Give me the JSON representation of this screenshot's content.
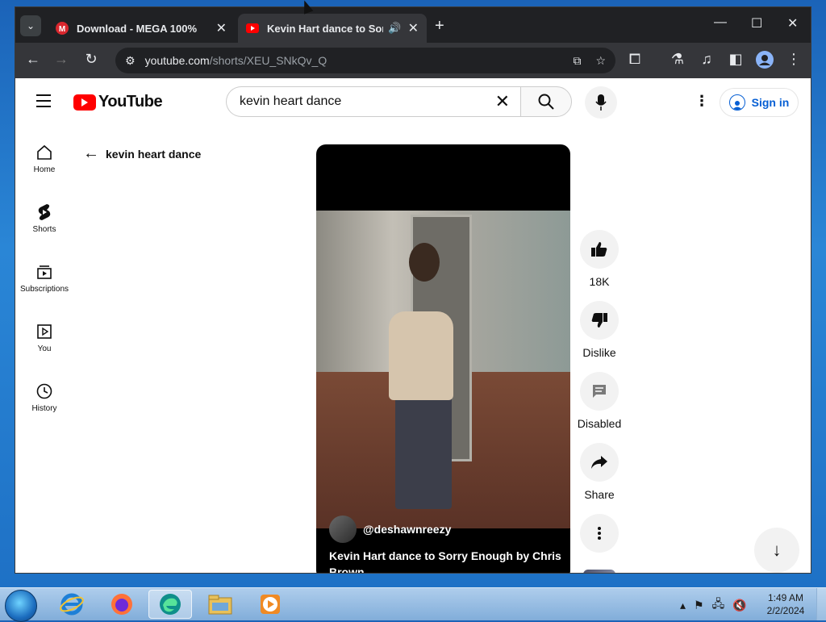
{
  "browser": {
    "tabs": [
      {
        "title": "Download - MEGA 100%",
        "favicon": "mega-icon",
        "active": false
      },
      {
        "title": "Kevin Hart dance to Sorry Enough by Chris Brown",
        "favicon": "youtube-icon",
        "active": true,
        "audio": true
      }
    ],
    "url_host": "youtube.com",
    "url_path": "/shorts/XEU_SNkQv_Q"
  },
  "youtube": {
    "logo_text": "YouTube",
    "search_value": "kevin heart dance",
    "signin_label": "Sign in",
    "sidebar": [
      {
        "label": "Home",
        "icon": "home-icon"
      },
      {
        "label": "Shorts",
        "icon": "shorts-icon"
      },
      {
        "label": "Subscriptions",
        "icon": "subscriptions-icon"
      },
      {
        "label": "You",
        "icon": "you-icon"
      },
      {
        "label": "History",
        "icon": "history-icon"
      }
    ],
    "back_label": "kevin heart dance",
    "short": {
      "channel": "@deshawnreezy",
      "title": "Kevin Hart dance to Sorry Enough by Chris Brown"
    },
    "actions": {
      "like": "18K",
      "dislike": "Dislike",
      "comments": "Disabled",
      "share": "Share"
    }
  },
  "taskbar": {
    "time": "1:49 AM",
    "date": "2/2/2024",
    "apps": [
      "ie-icon",
      "firefox-icon",
      "edge-icon",
      "explorer-icon",
      "media-player-icon"
    ]
  },
  "colors": {
    "youtube_red": "#ff0000",
    "link_blue": "#065fd4",
    "chrome_dark": "#202124"
  }
}
